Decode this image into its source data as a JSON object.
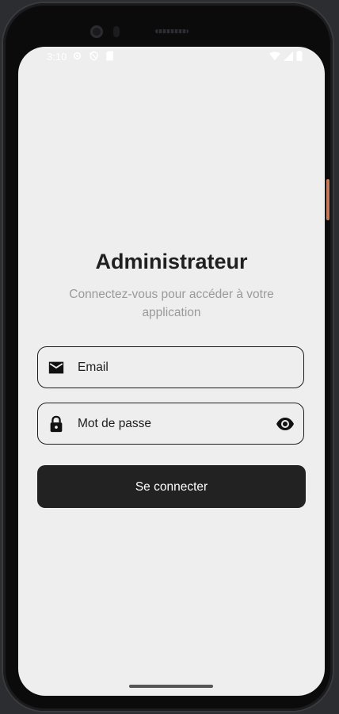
{
  "status_bar": {
    "time": "3:10",
    "left_icons": [
      "settings-icon",
      "shield-icon",
      "sd-card-icon"
    ],
    "right_icons": [
      "wifi-icon",
      "signal-icon",
      "battery-icon"
    ]
  },
  "login": {
    "title": "Administrateur",
    "subtitle": "Connectez-vous pour accéder à votre application",
    "email": {
      "placeholder": "Email",
      "value": "",
      "icon": "mail-icon"
    },
    "password": {
      "placeholder": "Mot de passe",
      "value": "",
      "icon": "lock-icon",
      "toggle_icon": "eye-icon"
    },
    "submit_label": "Se connecter"
  },
  "colors": {
    "background": "#eeeeee",
    "button": "#222222",
    "button_text": "#ffffff",
    "title": "#202020",
    "subtitle": "#9a9a9a",
    "border": "#1e1e1e"
  }
}
